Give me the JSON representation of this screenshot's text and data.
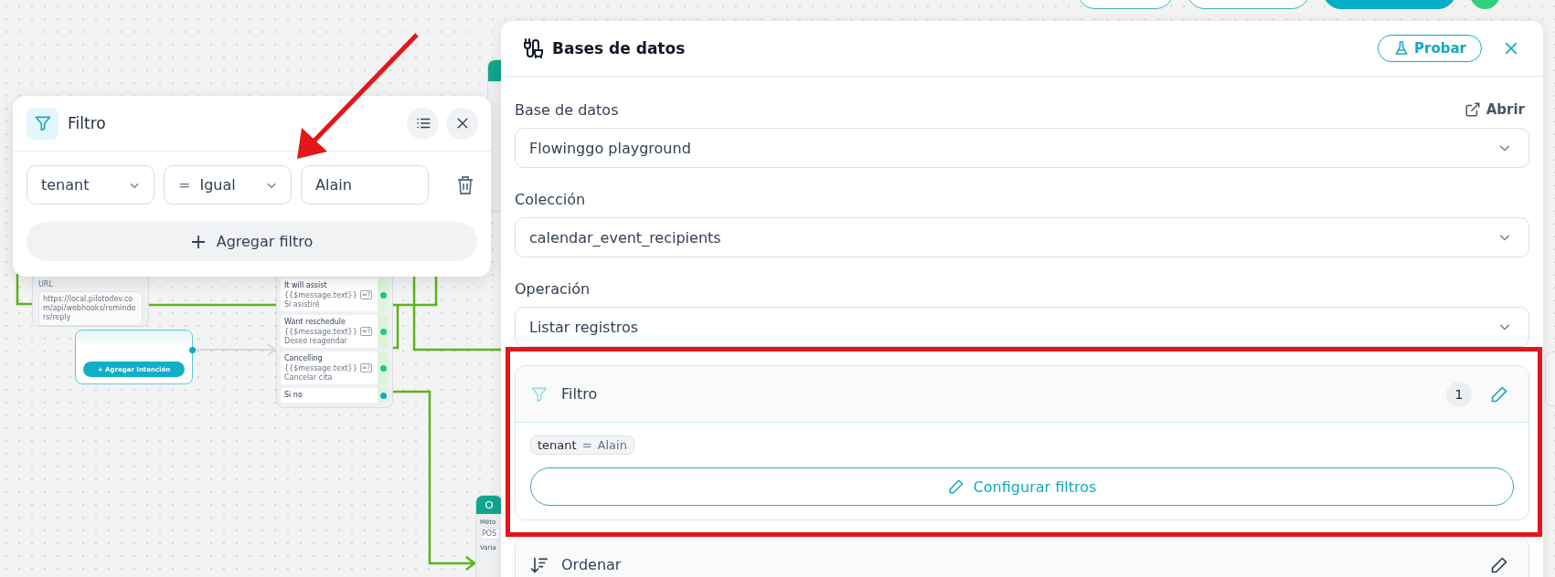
{
  "canvas": {
    "url_node": {
      "label": "URL",
      "value": "https://local.pilotodev.com/api/webhooks/reminders/reply"
    },
    "intent_node": {
      "button": "+ Agregar Intención"
    },
    "conditions_node": {
      "items": [
        {
          "kind": "condition",
          "title": "It will assist",
          "variable": "{{$message.text}}",
          "operator": "=?",
          "value": "Sí asistiré"
        },
        {
          "kind": "condition",
          "title": "Want reschedule",
          "variable": "{{$message.text}}",
          "operator": "=?",
          "value": "Deseo reagendar"
        },
        {
          "kind": "condition",
          "title": "Cancelling",
          "variable": "{{$message.text}}",
          "operator": "=?",
          "value": "Cancelar cita"
        },
        {
          "kind": "else",
          "title": "Si no"
        }
      ]
    },
    "http_node": {
      "method_label": "Méto",
      "method_value": "POS",
      "variables_label": "Varia"
    }
  },
  "filter_popup": {
    "title": "Filtro",
    "filters": [
      {
        "field": "tenant",
        "operator_symbol": "=",
        "operator": "Igual",
        "value": "Alain"
      }
    ],
    "add_button": "Agregar filtro"
  },
  "panel": {
    "title": "Bases de datos",
    "test_button": "Probar",
    "fields": [
      {
        "label": "Base de datos",
        "value": "Flowinggo playground",
        "action": "Abrir"
      },
      {
        "label": "Colección",
        "value": "calendar_event_recipients"
      },
      {
        "label": "Operación",
        "value": "Listar registros"
      }
    ],
    "filter_section": {
      "title": "Filtro",
      "count": "1",
      "chips": [
        {
          "field": "tenant",
          "operator": "=",
          "value": "Alain"
        }
      ],
      "button": "Configurar filtros"
    },
    "sort_section": {
      "title": "Ordenar"
    }
  }
}
